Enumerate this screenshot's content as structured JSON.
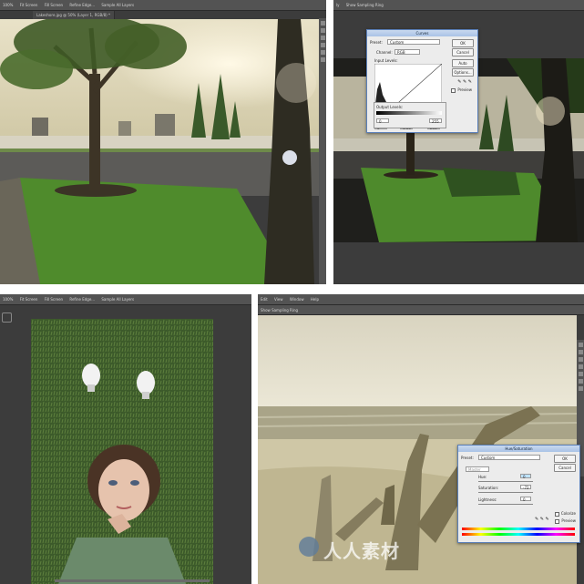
{
  "panel1": {
    "menu_text": "ly",
    "options": [
      "100%",
      "Fit Screen",
      "Fill Screen",
      "Refine Edge...",
      "Sample All Layers"
    ],
    "doc_tab": "Lakeshore.jpg @ 50% (Layer 1, RGB/8) *"
  },
  "panel2": {
    "menu_text": "ly",
    "options": [
      "Show Sampling Ring"
    ],
    "curves": {
      "title": "Curves",
      "preset_label": "Preset:",
      "preset_value": "Custom",
      "channel_label": "Channel:",
      "channel_value": "RGB",
      "input_levels_label": "Input Levels:",
      "input_values": [
        "0",
        "1.00",
        "255"
      ],
      "output_levels_label": "Output Levels:",
      "output_values": [
        "0",
        "255"
      ],
      "buttons": [
        "OK",
        "Cancel",
        "Auto",
        "Options..."
      ],
      "preview_label": "Preview"
    }
  },
  "panel3": {
    "options": [
      "100%",
      "Fit Screen",
      "Fill Screen",
      "Refine Edge...",
      "Sample All Layers"
    ]
  },
  "panel4": {
    "menu_items": [
      "Edit",
      "View",
      "Window",
      "Help"
    ],
    "options": [
      "Show Sampling Ring"
    ],
    "huesat": {
      "title": "Hue/Saturation",
      "preset_label": "Preset:",
      "preset_value": "Custom",
      "channel_value": "Master",
      "hue_label": "Hue:",
      "hue_value": "0",
      "saturation_label": "Saturation:",
      "saturation_value": "-72",
      "lightness_label": "Lightness:",
      "lightness_value": "0",
      "buttons": [
        "OK",
        "Cancel"
      ],
      "colorize_label": "Colorize",
      "preview_label": "Preview"
    }
  },
  "watermark": "人人素材",
  "colors": {
    "ps_bg": "#3c3c3c",
    "ps_bar": "#535353",
    "dialog_bg": "#ececec",
    "dialog_title": "#b8cde9",
    "grass": "#4d8a2a",
    "sepia": "#c9c2a2"
  }
}
